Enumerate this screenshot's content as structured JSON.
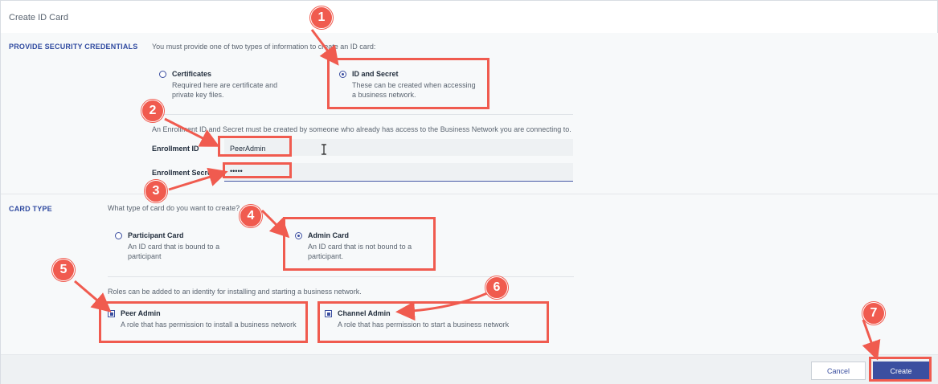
{
  "dialog": {
    "title": "Create ID Card"
  },
  "credentials": {
    "section_label": "PROVIDE SECURITY CREDENTIALS",
    "intro": "You must provide one of two types of information to create an ID card:",
    "options": [
      {
        "title": "Certificates",
        "desc": "Required here are certificate and private key files.",
        "selected": false
      },
      {
        "title": "ID and Secret",
        "desc": "These can be created when accessing a business network.",
        "selected": true
      }
    ],
    "enroll_note": "An Enrollment ID and Secret must be created by someone who already has access to the Business Network you are connecting to.",
    "enrollment_id_label": "Enrollment ID",
    "enrollment_id_value": "PeerAdmin",
    "enrollment_secret_label": "Enrollment Secret",
    "enrollment_secret_value": "•••••"
  },
  "card_type": {
    "section_label": "CARD TYPE",
    "intro": "What type of card do you want to create?",
    "options": [
      {
        "title": "Participant Card",
        "desc": "An ID card that is bound to a participant",
        "selected": false
      },
      {
        "title": "Admin Card",
        "desc": "An ID card that is not bound to a participant.",
        "selected": true
      }
    ],
    "roles_note": "Roles can be added to an identity for installing and starting a business network.",
    "roles": [
      {
        "title": "Peer Admin",
        "desc": "A role that has permission to install a business network",
        "checked": true
      },
      {
        "title": "Channel Admin",
        "desc": "A role that has permission to start a business network",
        "checked": true
      }
    ]
  },
  "footer": {
    "cancel_label": "Cancel",
    "create_label": "Create"
  },
  "annotations": {
    "badges": [
      "1",
      "2",
      "3",
      "4",
      "5",
      "6",
      "7"
    ],
    "color": "#f05b4f"
  },
  "colors": {
    "accent": "#3b4fa0",
    "section_bg": "#f7f9fa"
  }
}
